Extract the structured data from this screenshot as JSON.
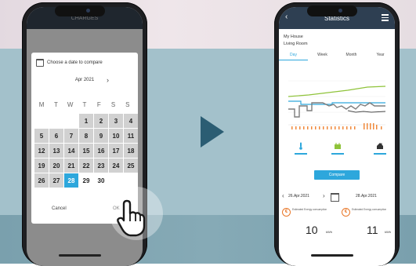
{
  "left_phone": {
    "app_title": "CHARGES",
    "dialog": {
      "title": "Choose a date to compare",
      "month": "Apr 2021",
      "weekdays": [
        "M",
        "T",
        "W",
        "T",
        "F",
        "S",
        "S"
      ],
      "days": [
        "",
        "",
        "",
        "1",
        "2",
        "3",
        "4",
        "5",
        "6",
        "7",
        "8",
        "9",
        "10",
        "11",
        "12",
        "13",
        "14",
        "15",
        "16",
        "17",
        "18",
        "19",
        "20",
        "21",
        "22",
        "23",
        "24",
        "25",
        "26",
        "27",
        "28",
        "29",
        "30",
        "",
        ""
      ],
      "disabled_days_after": 28,
      "selected_day": "28",
      "cancel_label": "Cancel",
      "ok_label": "OK"
    }
  },
  "right_phone": {
    "title": "Statistics",
    "location_line1": "My House",
    "location_line2": "Living Room",
    "tabs": [
      "Day",
      "Week",
      "Month",
      "Year"
    ],
    "active_tab": "Day",
    "compare_label": "Compare",
    "date_left": "26.Apr.2021",
    "date_right": "28.Apr.2021",
    "consumption_label": "Estimated Energy consumption",
    "value_left": "10",
    "value_right": "11",
    "unit": "kWh"
  },
  "colors": {
    "accent_blue": "#2da7dc",
    "header_dark": "#2e3f52",
    "arrow": "#2b5d73",
    "orange": "#e9782a",
    "line_green": "#8fc33a",
    "line_gray": "#7d7d7d",
    "bars_orange": "#f08a3c"
  }
}
